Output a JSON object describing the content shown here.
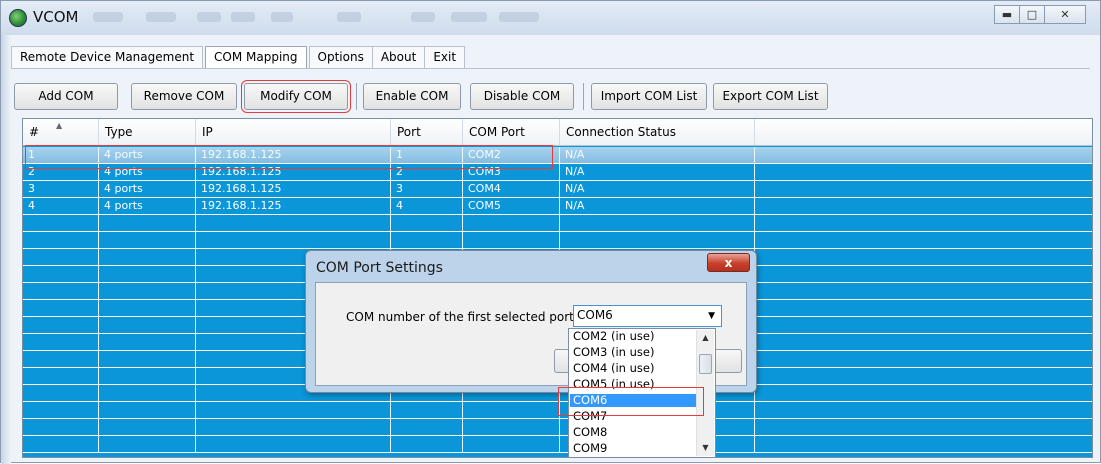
{
  "window": {
    "title": "VCOM",
    "controls": [
      "minimize",
      "maximize",
      "close"
    ]
  },
  "tabs": [
    {
      "label": "Remote Device Management"
    },
    {
      "label": "COM Mapping"
    },
    {
      "label": "Options"
    },
    {
      "label": "About"
    },
    {
      "label": "Exit"
    }
  ],
  "toolbar": {
    "add_com": "Add COM",
    "remove_com": "Remove COM",
    "modify_com": "Modify COM",
    "enable_com": "Enable COM",
    "disable_com": "Disable COM",
    "import_list": "Import COM List",
    "export_list": "Export COM List"
  },
  "table": {
    "columns": [
      "#",
      "Type",
      "IP",
      "Port",
      "COM Port",
      "Connection Status"
    ],
    "rows": [
      [
        "1",
        "4 ports",
        "192.168.1.125",
        "1",
        "COM2",
        "N/A"
      ],
      [
        "2",
        "4 ports",
        "192.168.1.125",
        "2",
        "COM3",
        "N/A"
      ],
      [
        "3",
        "4 ports",
        "192.168.1.125",
        "3",
        "COM4",
        "N/A"
      ],
      [
        "4",
        "4 ports",
        "192.168.1.125",
        "4",
        "COM5",
        "N/A"
      ]
    ]
  },
  "dialog": {
    "title": "COM Port Settings",
    "close_glyph": "x",
    "label": "COM number of the first selected port",
    "combo_value": "COM6",
    "options": [
      "COM2  (in use)",
      "COM3  (in use)",
      "COM4  (in use)",
      "COM5  (in use)",
      "COM6",
      "COM7",
      "COM8",
      "COM9"
    ]
  },
  "colors": {
    "grid_bg": "#0a96d8",
    "selected_row": "#9fcde9",
    "highlight": "#e53b3b",
    "option_selected": "#3399ff"
  }
}
